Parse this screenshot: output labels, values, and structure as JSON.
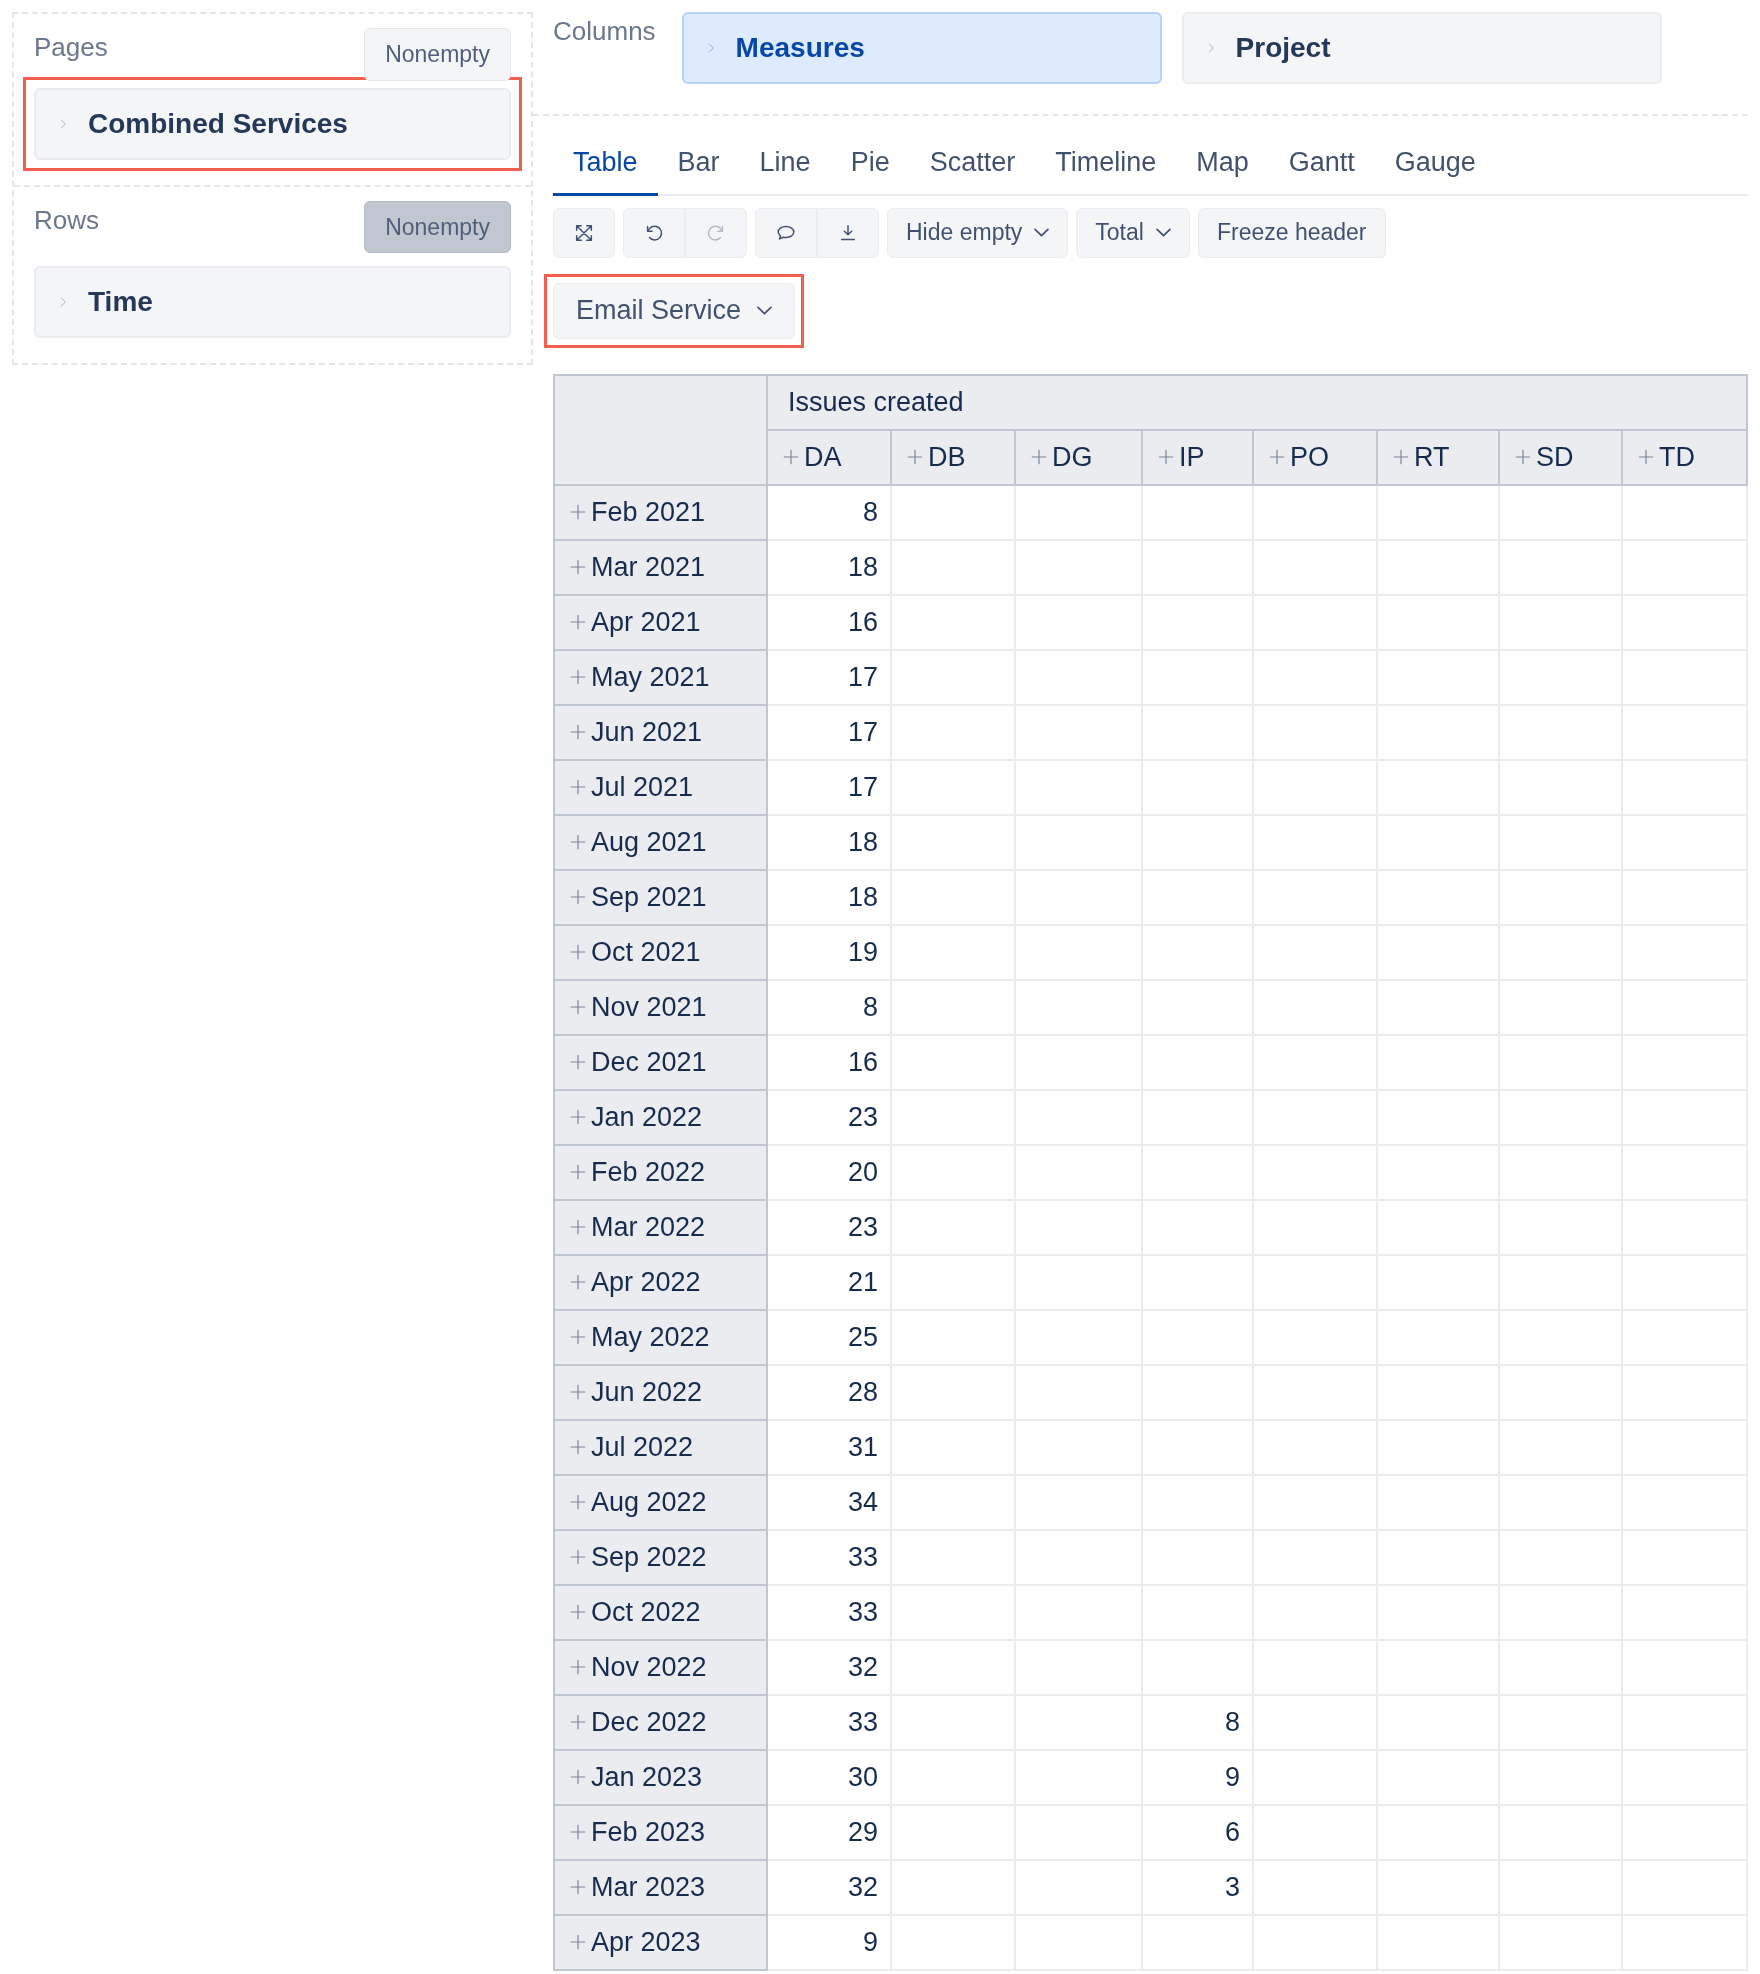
{
  "pages": {
    "title": "Pages",
    "nonempty": {
      "label": "Nonempty",
      "selected": false
    },
    "items": [
      {
        "label": "Combined Services",
        "highlighted": true
      }
    ]
  },
  "rows": {
    "title": "Rows",
    "nonempty": {
      "label": "Nonempty",
      "selected": true
    },
    "items": [
      {
        "label": "Time",
        "highlighted": false
      }
    ]
  },
  "columns": {
    "title": "Columns",
    "items": [
      {
        "label": "Measures",
        "selected": true
      },
      {
        "label": "Project",
        "selected": false
      }
    ]
  },
  "tabs": [
    {
      "label": "Table",
      "selected": true
    },
    {
      "label": "Bar",
      "selected": false
    },
    {
      "label": "Line",
      "selected": false
    },
    {
      "label": "Pie",
      "selected": false
    },
    {
      "label": "Scatter",
      "selected": false
    },
    {
      "label": "Timeline",
      "selected": false
    },
    {
      "label": "Map",
      "selected": false
    },
    {
      "label": "Gantt",
      "selected": false
    },
    {
      "label": "Gauge",
      "selected": false
    }
  ],
  "toolbar": {
    "redo_disabled": true,
    "hide_empty": "Hide empty",
    "total": "Total",
    "freeze": "Freeze header"
  },
  "page_filter": {
    "value": "Email Service",
    "highlighted": true
  },
  "table": {
    "measure": "Issues created",
    "columns": [
      "DA",
      "DB",
      "DG",
      "IP",
      "PO",
      "RT",
      "SD",
      "TD"
    ],
    "rows": [
      {
        "label": "Feb 2021",
        "cells": [
          "8",
          null,
          null,
          null,
          null,
          null,
          null,
          null
        ]
      },
      {
        "label": "Mar 2021",
        "cells": [
          "18",
          null,
          null,
          null,
          null,
          null,
          null,
          null
        ]
      },
      {
        "label": "Apr 2021",
        "cells": [
          "16",
          null,
          null,
          null,
          null,
          null,
          null,
          null
        ]
      },
      {
        "label": "May 2021",
        "cells": [
          "17",
          null,
          null,
          null,
          null,
          null,
          null,
          null
        ]
      },
      {
        "label": "Jun 2021",
        "cells": [
          "17",
          null,
          null,
          null,
          null,
          null,
          null,
          null
        ]
      },
      {
        "label": "Jul 2021",
        "cells": [
          "17",
          null,
          null,
          null,
          null,
          null,
          null,
          null
        ]
      },
      {
        "label": "Aug 2021",
        "cells": [
          "18",
          null,
          null,
          null,
          null,
          null,
          null,
          null
        ]
      },
      {
        "label": "Sep 2021",
        "cells": [
          "18",
          null,
          null,
          null,
          null,
          null,
          null,
          null
        ]
      },
      {
        "label": "Oct 2021",
        "cells": [
          "19",
          null,
          null,
          null,
          null,
          null,
          null,
          null
        ]
      },
      {
        "label": "Nov 2021",
        "cells": [
          "8",
          null,
          null,
          null,
          null,
          null,
          null,
          null
        ]
      },
      {
        "label": "Dec 2021",
        "cells": [
          "16",
          null,
          null,
          null,
          null,
          null,
          null,
          null
        ]
      },
      {
        "label": "Jan 2022",
        "cells": [
          "23",
          null,
          null,
          null,
          null,
          null,
          null,
          null
        ]
      },
      {
        "label": "Feb 2022",
        "cells": [
          "20",
          null,
          null,
          null,
          null,
          null,
          null,
          null
        ]
      },
      {
        "label": "Mar 2022",
        "cells": [
          "23",
          null,
          null,
          null,
          null,
          null,
          null,
          null
        ]
      },
      {
        "label": "Apr 2022",
        "cells": [
          "21",
          null,
          null,
          null,
          null,
          null,
          null,
          null
        ]
      },
      {
        "label": "May 2022",
        "cells": [
          "25",
          null,
          null,
          null,
          null,
          null,
          null,
          null
        ]
      },
      {
        "label": "Jun 2022",
        "cells": [
          "28",
          null,
          null,
          null,
          null,
          null,
          null,
          null
        ]
      },
      {
        "label": "Jul 2022",
        "cells": [
          "31",
          null,
          null,
          null,
          null,
          null,
          null,
          null
        ]
      },
      {
        "label": "Aug 2022",
        "cells": [
          "34",
          null,
          null,
          null,
          null,
          null,
          null,
          null
        ]
      },
      {
        "label": "Sep 2022",
        "cells": [
          "33",
          null,
          null,
          null,
          null,
          null,
          null,
          null
        ]
      },
      {
        "label": "Oct 2022",
        "cells": [
          "33",
          null,
          null,
          null,
          null,
          null,
          null,
          null
        ]
      },
      {
        "label": "Nov 2022",
        "cells": [
          "32",
          null,
          null,
          null,
          null,
          null,
          null,
          null
        ]
      },
      {
        "label": "Dec 2022",
        "cells": [
          "33",
          null,
          null,
          "8",
          null,
          null,
          null,
          null
        ]
      },
      {
        "label": "Jan 2023",
        "cells": [
          "30",
          null,
          null,
          "9",
          null,
          null,
          null,
          null
        ]
      },
      {
        "label": "Feb 2023",
        "cells": [
          "29",
          null,
          null,
          "6",
          null,
          null,
          null,
          null
        ]
      },
      {
        "label": "Mar 2023",
        "cells": [
          "32",
          null,
          null,
          "3",
          null,
          null,
          null,
          null
        ]
      },
      {
        "label": "Apr 2023",
        "cells": [
          "9",
          null,
          null,
          null,
          null,
          null,
          null,
          null
        ]
      }
    ]
  }
}
